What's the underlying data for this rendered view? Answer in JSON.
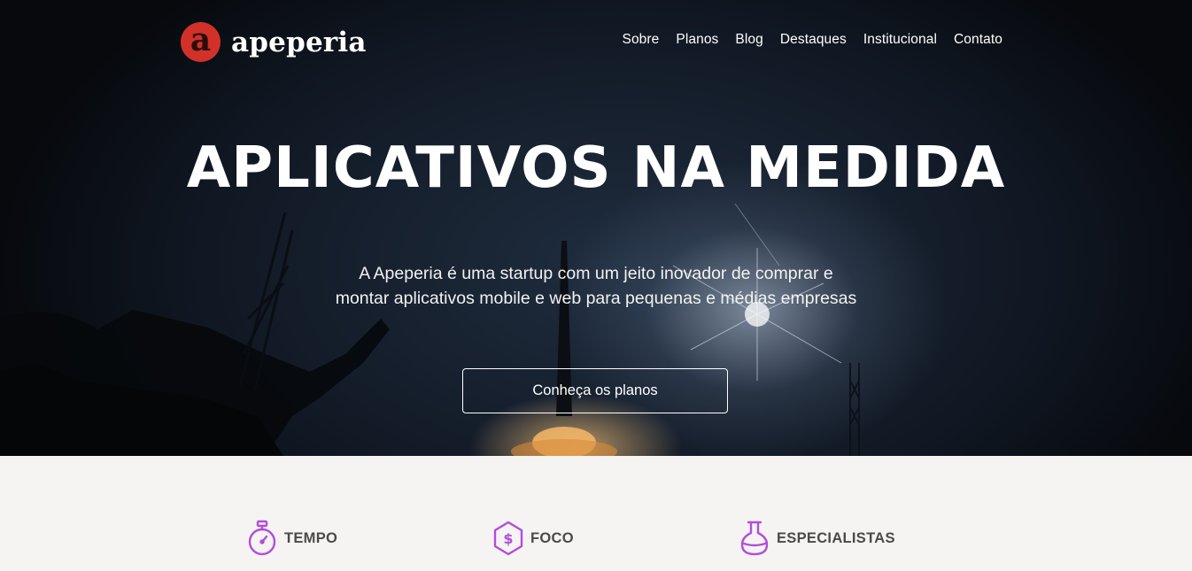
{
  "brand": {
    "name": "apeperia",
    "badge_letter": "a",
    "accent": "#d2312a"
  },
  "nav": {
    "items": [
      {
        "label": "Sobre"
      },
      {
        "label": "Planos"
      },
      {
        "label": "Blog"
      },
      {
        "label": "Destaques"
      },
      {
        "label": "Institucional"
      },
      {
        "label": "Contato"
      }
    ]
  },
  "hero": {
    "headline": "APLICATIVOS NA MEDIDA",
    "lead": "A Apeperia é uma startup com um jeito inovador de comprar e montar aplicativos mobile e web para pequenas e médias empresas",
    "cta_label": "Conheça os planos"
  },
  "features": {
    "icon_color": "#b24ddb",
    "items": [
      {
        "icon": "stopwatch-icon",
        "title": "TEMPO"
      },
      {
        "icon": "hexagon-dollar-icon",
        "title": "FOCO"
      },
      {
        "icon": "flask-icon",
        "title": "ESPECIALISTAS"
      }
    ]
  }
}
